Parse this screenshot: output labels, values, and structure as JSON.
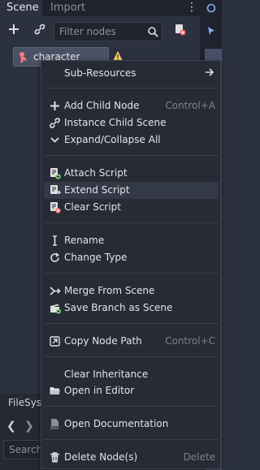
{
  "tabs": {
    "scene": "Scene",
    "import": "Import"
  },
  "filter": {
    "placeholder": "Filter nodes"
  },
  "tree": {
    "node_name": "character"
  },
  "lower_dock": {
    "tab": "FileSyst",
    "search": "Search"
  },
  "menu": {
    "items": [
      {
        "id": "sub-resources",
        "label": "Sub-Resources",
        "shortcut": "",
        "icon": "none",
        "submenu": true
      },
      {
        "id": "add-child-node",
        "label": "Add Child Node",
        "shortcut": "Control+A",
        "icon": "plus-icon"
      },
      {
        "id": "instance-child-scene",
        "label": "Instance Child Scene",
        "shortcut": "",
        "icon": "link-icon"
      },
      {
        "id": "expand-collapse-all",
        "label": "Expand/Collapse All",
        "shortcut": "",
        "icon": "chevron-down-icon"
      },
      {
        "id": "attach-script",
        "label": "Attach Script",
        "shortcut": "",
        "icon": "script-add-icon"
      },
      {
        "id": "extend-script",
        "label": "Extend Script",
        "shortcut": "",
        "icon": "script-extend-icon",
        "hover": true
      },
      {
        "id": "clear-script",
        "label": "Clear Script",
        "shortcut": "",
        "icon": "script-remove-icon"
      },
      {
        "id": "rename",
        "label": "Rename",
        "shortcut": "",
        "icon": "text-cursor-icon"
      },
      {
        "id": "change-type",
        "label": "Change Type",
        "shortcut": "",
        "icon": "rotate-icon"
      },
      {
        "id": "merge-from-scene",
        "label": "Merge From Scene",
        "shortcut": "",
        "icon": "merge-icon"
      },
      {
        "id": "save-branch-as-scene",
        "label": "Save Branch as Scene",
        "shortcut": "",
        "icon": "clapper-icon"
      },
      {
        "id": "copy-node-path",
        "label": "Copy Node Path",
        "shortcut": "Control+C",
        "icon": "copy-path-icon"
      },
      {
        "id": "clear-inheritance",
        "label": "Clear Inheritance",
        "shortcut": "",
        "icon": "none"
      },
      {
        "id": "open-in-editor",
        "label": "Open in Editor",
        "shortcut": "",
        "icon": "folder-open-icon"
      },
      {
        "id": "open-documentation",
        "label": "Open Documentation",
        "shortcut": "",
        "icon": "doc-icon"
      },
      {
        "id": "delete-nodes",
        "label": "Delete Node(s)",
        "shortcut": "Delete",
        "icon": "trash-icon"
      }
    ]
  },
  "colors": {
    "menu_bg": "#272b35",
    "hover_bg": "#343947",
    "text": "#e2e4e8",
    "shortcut": "#7c818c",
    "script_green": "#7dd87a",
    "script_red": "#ff6b6b",
    "warning_yellow": "#ffd166"
  }
}
